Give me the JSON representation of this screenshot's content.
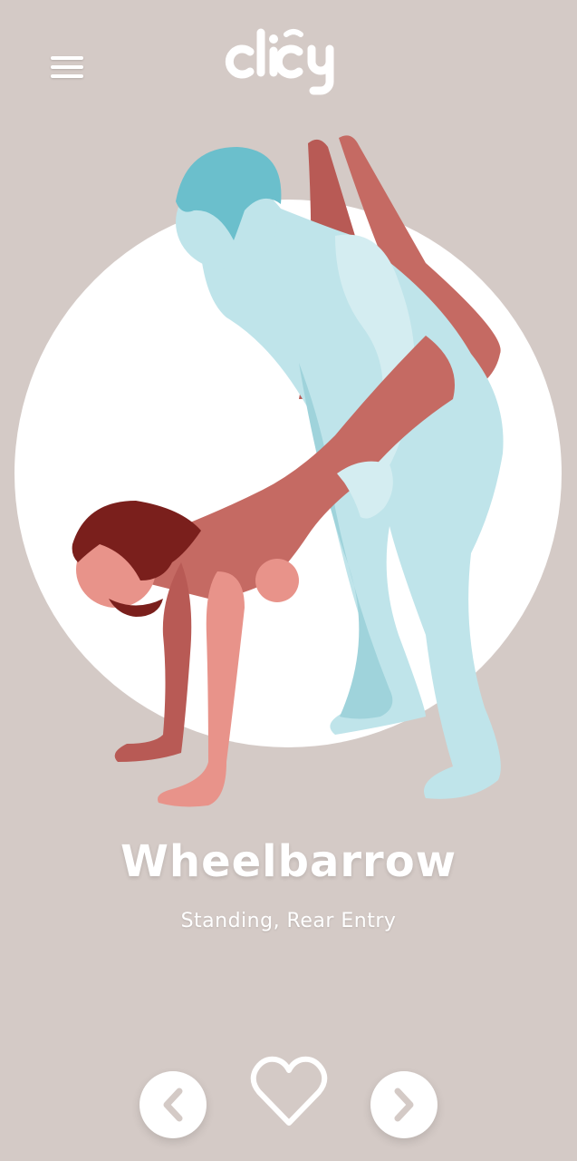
{
  "app": {
    "logo_text": "clicy"
  },
  "position": {
    "title": "Wheelbarrow",
    "subtitle": "Standing, Rear Entry"
  },
  "icons": {
    "menu": "hamburger-menu-icon",
    "previous": "chevron-left-icon",
    "next": "chevron-right-icon",
    "favorite": "heart-outline-icon"
  },
  "colors": {
    "background": "#d4cac6",
    "accent_teal": "#5fb8c6",
    "accent_red": "#c0605a",
    "white": "#ffffff"
  }
}
